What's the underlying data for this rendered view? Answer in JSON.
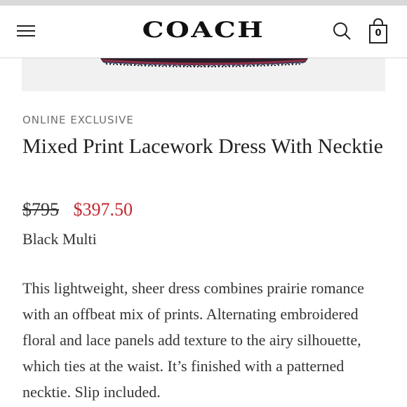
{
  "header": {
    "logo_text": "COACH",
    "bag_count": "0",
    "menu_icon": "hamburger-menu-icon",
    "search_icon": "search-icon",
    "bag_icon": "shopping-bag-icon"
  },
  "product": {
    "eyebrow": "ONLINE EXCLUSIVE",
    "title": "Mixed Print Lacework Dress With Necktie",
    "original_price": "$795",
    "sale_price": "$397.50",
    "color": "Black Multi",
    "description": "This lightweight, sheer dress combines prairie romance with an offbeat mix of prints. Alternating embroidered floral and lace panels add texture to the airy silhouette, which ties at the waist. It’s finished with a patterned necktie. Slip included."
  },
  "colors": {
    "sale": "#c2262e",
    "eyebrow": "#6f6f6f",
    "divider": "#d8d8d8"
  }
}
